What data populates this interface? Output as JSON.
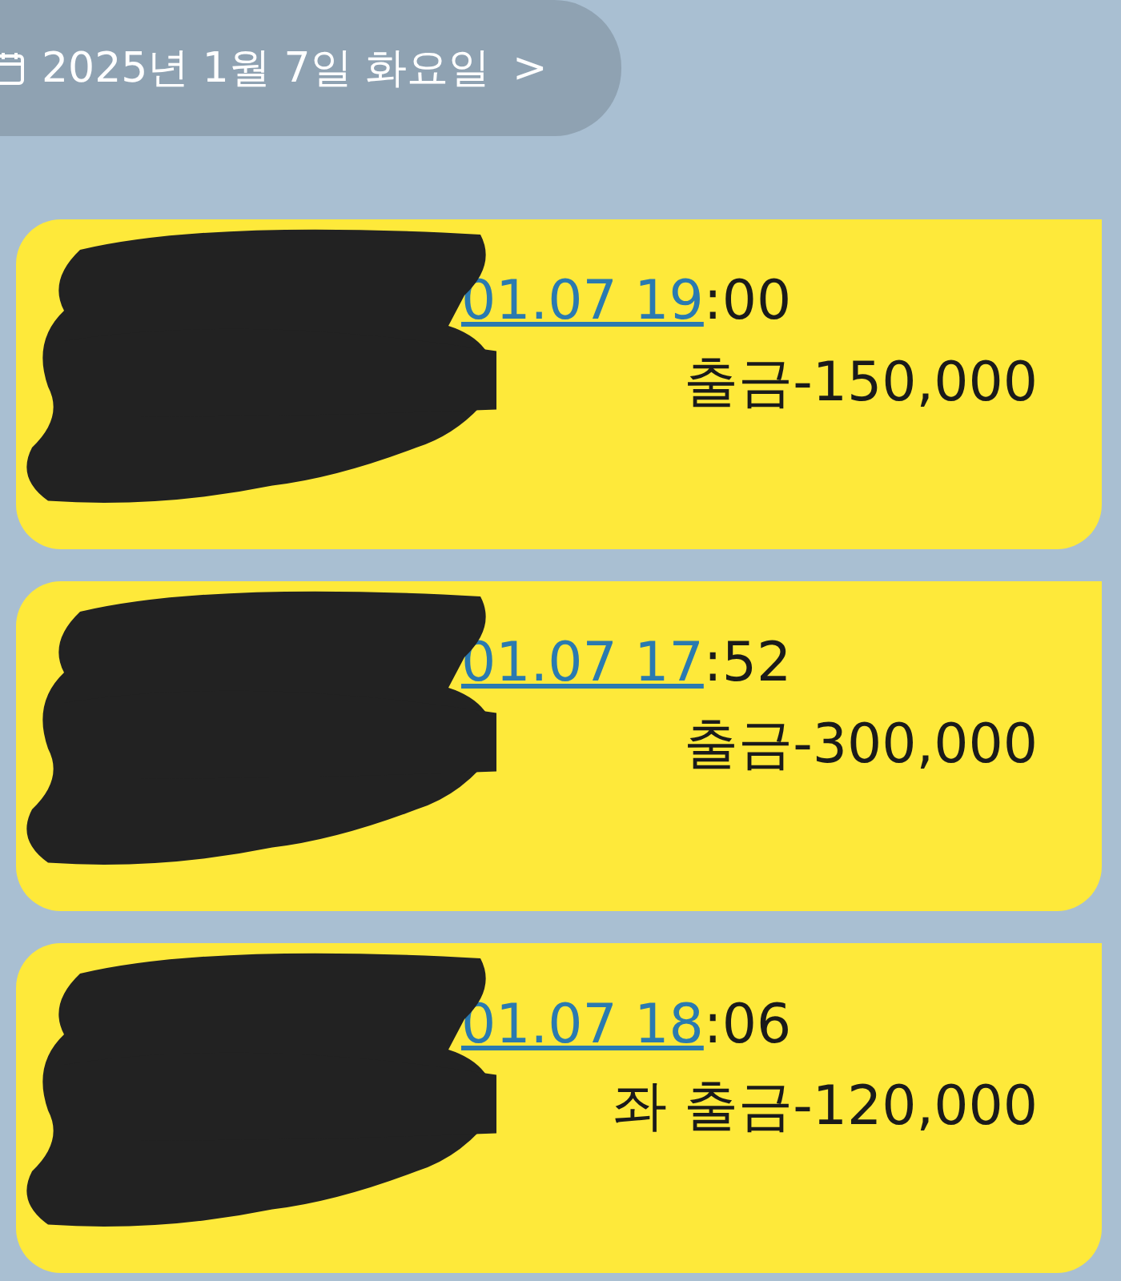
{
  "date_divider": {
    "label": "2025년 1월 7일 화요일",
    "chevron": ">"
  },
  "messages": [
    {
      "link": "01.07 19",
      "time_rest": ":00",
      "detail": "출금-150,000"
    },
    {
      "link": "01.07 17",
      "time_rest": ":52",
      "detail": "출금-300,000"
    },
    {
      "link": "01.07 18",
      "time_rest": ":06",
      "detail": "좌 출금-120,000"
    }
  ]
}
